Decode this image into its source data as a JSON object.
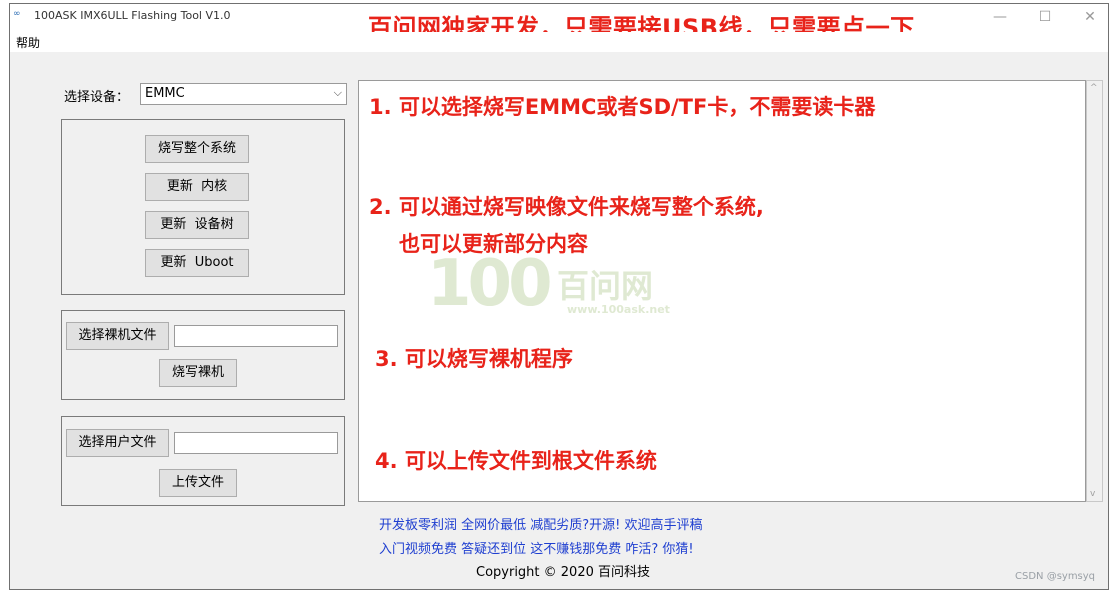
{
  "titlebar": {
    "title": "100ASK IMX6ULL Flashing Tool V1.0",
    "promo": "百问网独家开发，只需要接USB线，只需要点一下",
    "minimize": "—",
    "maximize": "☐",
    "close": "✕"
  },
  "menu": {
    "help": "帮助"
  },
  "device": {
    "label": "选择设备：",
    "selected": "EMMC",
    "arrow": "⌵"
  },
  "system_group": {
    "burn_system": "烧写整个系统",
    "update_kernel": "更新  内核",
    "update_dtb": "更新  设备树",
    "update_uboot": "更新  Uboot"
  },
  "baremetal_group": {
    "choose_file": "选择裸机文件",
    "file_value": "",
    "burn": "烧写裸机"
  },
  "user_group": {
    "choose_file": "选择用户文件",
    "file_value": "",
    "upload": "上传文件"
  },
  "log": {
    "line1": "1. 可以选择烧写EMMC或者SD/TF卡，不需要读卡器",
    "line2a": "2. 可以通过烧写映像文件来烧写整个系统,",
    "line2b": "也可以更新部分内容",
    "line3": "3. 可以烧写裸机程序",
    "line4": "4. 可以上传文件到根文件系统",
    "watermark_num": "100",
    "watermark_cn": "百问网",
    "watermark_url": "www.100ask.net"
  },
  "footer": {
    "links1": "开发板零利润  全网价最低  减配劣质?开源!  欢迎高手评稿",
    "links2": "入门视频免费  答疑还到位  这不赚钱那免费  咋活? 你猜!",
    "copyright": "Copyright © 2020 百问科技"
  },
  "watermark": "CSDN @symsyq",
  "colors": {
    "promo_red": "#e8231a",
    "link_blue": "#1f3fd0"
  }
}
